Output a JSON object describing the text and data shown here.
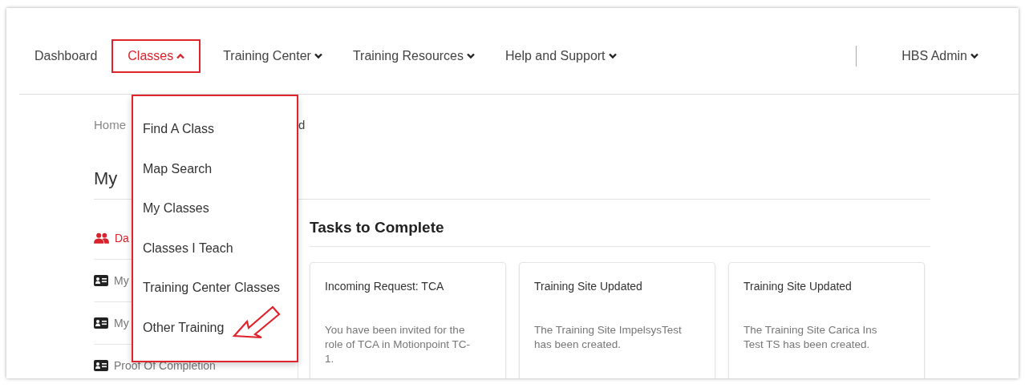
{
  "nav": {
    "items": [
      {
        "label": "Dashboard",
        "has_menu": false,
        "selected": false,
        "highlighted": false
      },
      {
        "label": "Classes",
        "has_menu": true,
        "expanded": true,
        "selected": true,
        "highlighted": true
      },
      {
        "label": "Training Center",
        "has_menu": true,
        "expanded": false,
        "selected": false,
        "highlighted": false
      },
      {
        "label": "Training Resources",
        "has_menu": true,
        "expanded": false,
        "selected": false,
        "highlighted": false
      },
      {
        "label": "Help and Support",
        "has_menu": true,
        "expanded": false,
        "selected": false,
        "highlighted": false
      }
    ],
    "user": {
      "label": "HBS Admin",
      "expanded": false
    }
  },
  "dropdown": {
    "highlighted": true,
    "items": [
      {
        "label": "Find A Class",
        "pointed": false
      },
      {
        "label": "Map Search",
        "pointed": false
      },
      {
        "label": "My Classes",
        "pointed": false
      },
      {
        "label": "Classes I Teach",
        "pointed": false
      },
      {
        "label": "Training Center Classes",
        "pointed": false
      },
      {
        "label": "Other Training",
        "pointed": true
      }
    ]
  },
  "breadcrumb": [
    "Home",
    "d"
  ],
  "heading": "My",
  "sidebar": {
    "items": [
      {
        "label": "Da",
        "kind": "group",
        "selected": true
      },
      {
        "label": "My",
        "kind": "card",
        "selected": false
      },
      {
        "label": "My",
        "kind": "card",
        "selected": false
      },
      {
        "label": "Proof Of Completion",
        "kind": "card",
        "selected": false
      }
    ]
  },
  "tasks": {
    "title": "Tasks to Complete",
    "cards": [
      {
        "title": "Incoming Request: TCA",
        "body": "You have been invited for the role of TCA in Motionpoint TC-1."
      },
      {
        "title": "Training Site Updated",
        "body": "The Training Site ImpelsysTest has been created."
      },
      {
        "title": "Training Site Updated",
        "body": "The Training Site Carica Ins Test TS has been created."
      }
    ]
  }
}
